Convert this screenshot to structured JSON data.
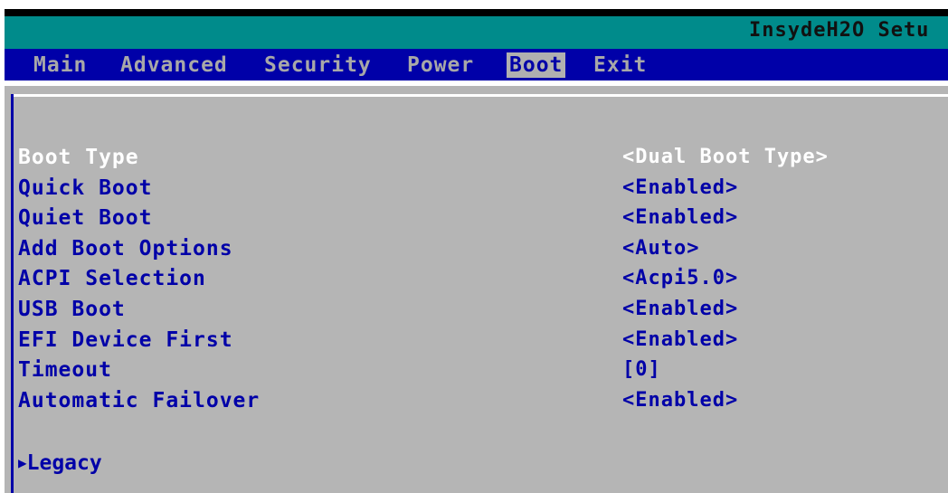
{
  "title": "InsydeH2O Setu",
  "menu": [
    {
      "label": "Main"
    },
    {
      "label": "Advanced"
    },
    {
      "label": "Security"
    },
    {
      "label": "Power"
    },
    {
      "label": "Boot",
      "active": true
    },
    {
      "label": "Exit"
    }
  ],
  "settings": [
    {
      "label": "Boot Type",
      "value": "<Dual Boot Type>"
    },
    {
      "label": "Quick Boot",
      "value": "<Enabled>"
    },
    {
      "label": "Quiet Boot",
      "value": "<Enabled>"
    },
    {
      "label": "Add Boot Options",
      "value": "<Auto>"
    },
    {
      "label": "ACPI Selection",
      "value": "<Acpi5.0>"
    },
    {
      "label": "USB Boot",
      "value": "<Enabled>"
    },
    {
      "label": "EFI Device First",
      "value": "<Enabled>"
    },
    {
      "label": "Timeout",
      "value": "[0]"
    },
    {
      "label": "Automatic Failover",
      "value": "<Enabled>"
    }
  ],
  "submenu": {
    "arrow_icon": "▶",
    "label": "Legacy"
  },
  "colors": {
    "title_bar": "#008b8b",
    "menu_bar": "#0000a8",
    "panel": "#b5b5b5",
    "text_blue": "#0000a8",
    "selected_text": "#ffffff"
  }
}
